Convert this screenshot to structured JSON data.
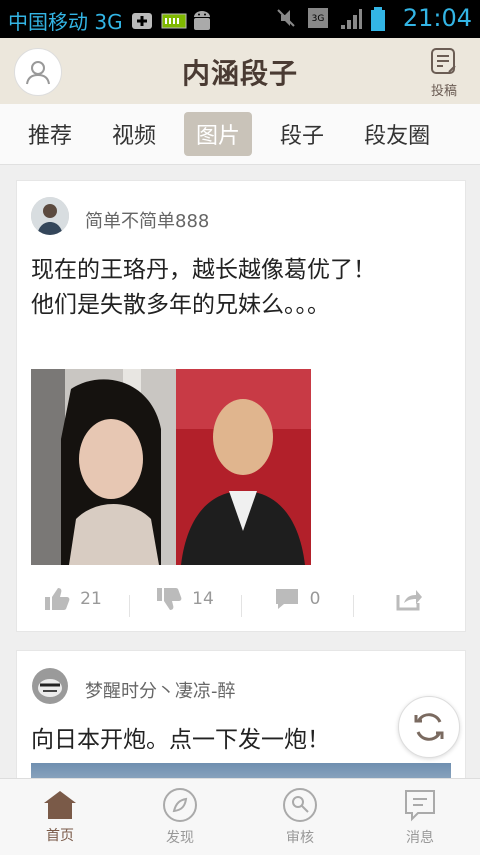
{
  "status_bar": {
    "carrier": "中国移动 3G",
    "time": "21:04",
    "network": "3G"
  },
  "header": {
    "logo": "内涵段子",
    "post_label": "投稿"
  },
  "tabs": [
    {
      "label": "推荐",
      "active": false
    },
    {
      "label": "视频",
      "active": false
    },
    {
      "label": "图片",
      "active": true
    },
    {
      "label": "段子",
      "active": false
    },
    {
      "label": "段友圈",
      "active": false
    }
  ],
  "posts": [
    {
      "username": "简单不简单888",
      "text": "现在的王珞丹，越长越像葛优了！他们是失散多年的兄妹么。。。",
      "likes": "21",
      "dislikes": "14",
      "comments": "0"
    },
    {
      "username": "梦醒时分丶凄凉-醉",
      "text": "向日本开炮。点一下发一炮！"
    }
  ],
  "bottom_nav": [
    {
      "label": "首页",
      "icon": "home-icon",
      "active": true
    },
    {
      "label": "发现",
      "icon": "compass-icon",
      "active": false
    },
    {
      "label": "审核",
      "icon": "review-icon",
      "active": false
    },
    {
      "label": "消息",
      "icon": "message-icon",
      "active": false
    }
  ],
  "colors": {
    "accent": "#7a5a48",
    "header_bg": "#ece7dc",
    "status_blue": "#33b5e5"
  }
}
